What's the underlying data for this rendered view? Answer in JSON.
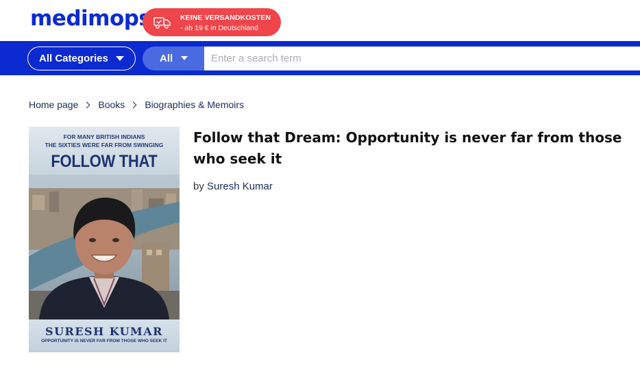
{
  "header": {
    "logo_text": "medimops",
    "promo": {
      "line1": "KEINE VERSANDKOSTEN",
      "line2": "- ab 19 € in Deutschland",
      "icon": "truck-icon"
    }
  },
  "search": {
    "category_label": "All Categories",
    "scope_label": "All",
    "placeholder": "Enter a search term",
    "value": ""
  },
  "breadcrumb": {
    "items": [
      "Home page",
      "Books",
      "Biographies & Memoirs"
    ]
  },
  "product": {
    "title": "Follow that Dream: Opportunity is never far from those who seek it",
    "by_prefix": "by",
    "author": "Suresh Kumar"
  },
  "cover": {
    "tagline_1": "FOR MANY BRITISH INDIANS",
    "tagline_2": "THE SIXTIES WERE FAR FROM SWINGING",
    "title": "FOLLOW THAT DREAM",
    "author": "SURESH KUMAR",
    "subtitle": "OPPORTUNITY IS NEVER FAR FROM THOSE WHO SEEK IT"
  },
  "colors": {
    "brand_blue": "#0b2ad0",
    "promo_red": "#f0454a",
    "scope_blue": "#4a6ae0"
  }
}
